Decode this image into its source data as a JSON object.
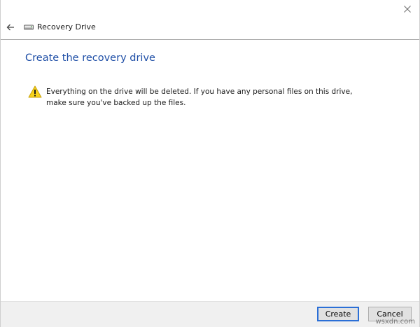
{
  "window": {
    "title": "Recovery Drive",
    "close_icon": "close-icon",
    "back_icon": "back-arrow-icon",
    "drive_icon": "drive-icon"
  },
  "main": {
    "heading": "Create the recovery drive",
    "heading_color": "#1e4ea6",
    "warning_icon": "warning-icon",
    "warning_text": "Everything on the drive will be deleted. If you have any personal files on this drive, make sure you've backed up the files."
  },
  "footer": {
    "create_label": "Create",
    "cancel_label": "Cancel"
  },
  "watermark": "wsxdn.com"
}
